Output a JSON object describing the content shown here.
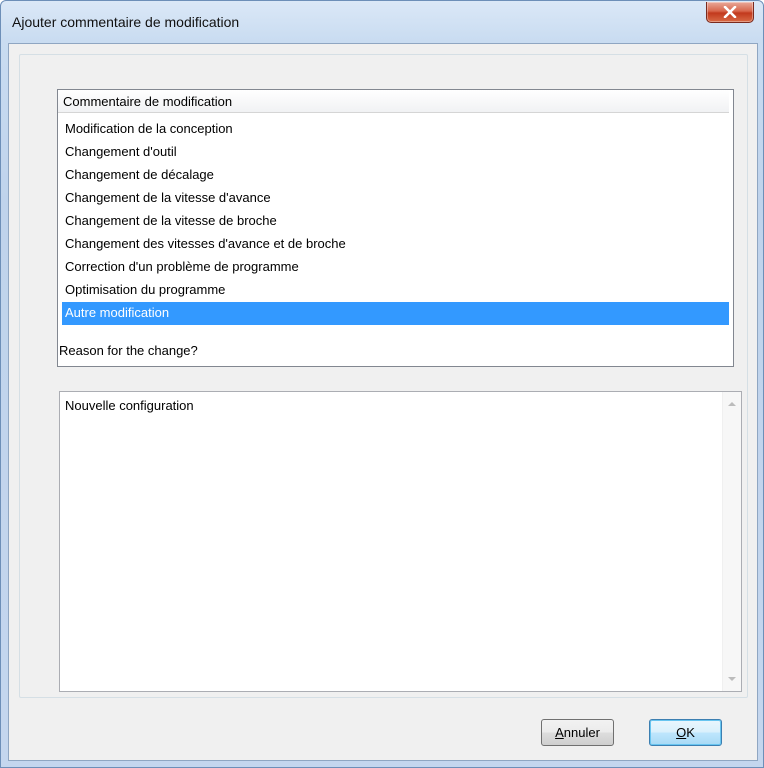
{
  "window": {
    "title": "Ajouter commentaire de modification"
  },
  "list": {
    "header": "Commentaire de modification",
    "items": [
      "Modification de la conception",
      "Changement d'outil",
      "Changement de décalage",
      "Changement de la vitesse d'avance",
      "Changement de la vitesse de broche",
      "Changement des vitesses d'avance et de broche",
      "Correction d'un problème de programme",
      "Optimisation du programme",
      "Autre modification"
    ],
    "selected": "Autre modification"
  },
  "reason": {
    "label": "Reason for the change?",
    "value": "Nouvelle configuration"
  },
  "buttons": {
    "cancel": {
      "label_first": "A",
      "label_rest": "nnuler"
    },
    "ok": {
      "label_first": "O",
      "label_rest": "K"
    }
  },
  "colors": {
    "selection": "#3399ff",
    "close_button": "#c2391d",
    "title_bar": "#c9dcf1"
  }
}
